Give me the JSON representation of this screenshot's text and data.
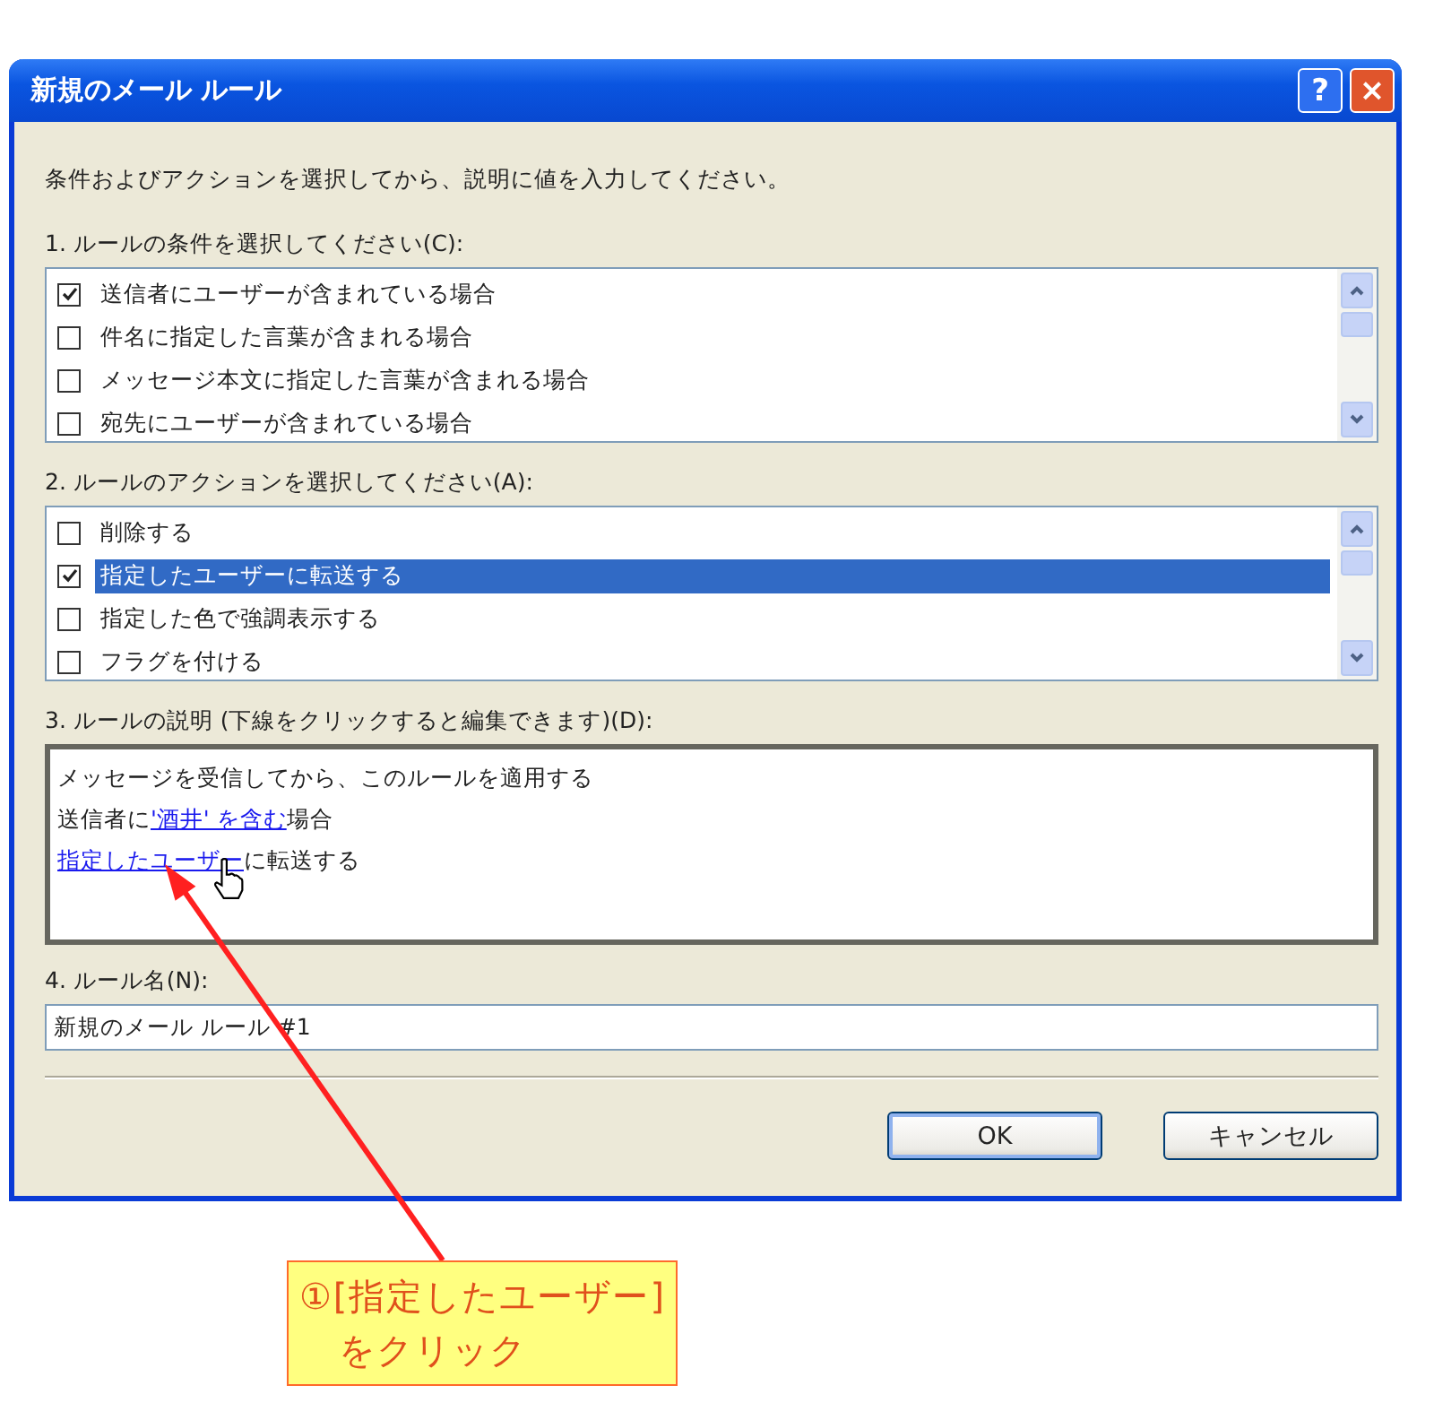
{
  "window": {
    "title": "新規のメール ルール",
    "help_button": "?",
    "close_button": "×"
  },
  "instruction": "条件およびアクションを選択してから、説明に値を入力してください。",
  "conditions": {
    "label": "1. ルールの条件を選択してください(C):",
    "items": [
      {
        "label": "送信者にユーザーが含まれている場合",
        "checked": true,
        "selected": false
      },
      {
        "label": "件名に指定した言葉が含まれる場合",
        "checked": false,
        "selected": false
      },
      {
        "label": "メッセージ本文に指定した言葉が含まれる場合",
        "checked": false,
        "selected": false
      },
      {
        "label": "宛先にユーザーが含まれている場合",
        "checked": false,
        "selected": false
      }
    ]
  },
  "actions": {
    "label": "2. ルールのアクションを選択してください(A):",
    "items": [
      {
        "label": "削除する",
        "checked": false,
        "selected": false
      },
      {
        "label": "指定したユーザーに転送する",
        "checked": true,
        "selected": true
      },
      {
        "label": "指定した色で強調表示する",
        "checked": false,
        "selected": false
      },
      {
        "label": "フラグを付ける",
        "checked": false,
        "selected": false
      }
    ]
  },
  "description": {
    "label": "3. ルールの説明 (下線をクリックすると編集できます)(D):",
    "lines": [
      [
        {
          "text": "メッセージを受信してから、このルールを適用する",
          "link": false
        }
      ],
      [
        {
          "text": "送信者に",
          "link": false
        },
        {
          "text": "'酒井' を含む",
          "link": true
        },
        {
          "text": "場合",
          "link": false
        }
      ],
      [
        {
          "text": "指定したユーザー",
          "link": true
        },
        {
          "text": "に転送する",
          "link": false
        }
      ]
    ]
  },
  "rule_name": {
    "label": "4. ルール名(N):",
    "value": "新規のメール ルール #1"
  },
  "buttons": [
    {
      "label": "OK",
      "default": true
    },
    {
      "label": "キャンセル",
      "default": false
    }
  ],
  "callout": {
    "lines": [
      "①[指定したユーザー]",
      "をクリック"
    ]
  }
}
